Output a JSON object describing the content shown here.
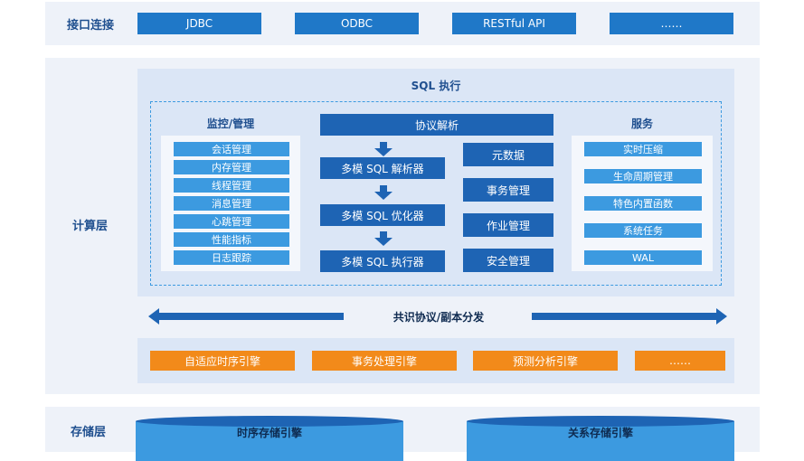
{
  "interface": {
    "label": "接口连接",
    "items": [
      "JDBC",
      "ODBC",
      "RESTful API",
      "……"
    ]
  },
  "compute": {
    "label": "计算层",
    "sql_title": "SQL 执行",
    "monitor": {
      "title": "监控/管理",
      "items": [
        "会话管理",
        "内存管理",
        "线程管理",
        "消息管理",
        "心跳管理",
        "性能指标",
        "日志跟踪"
      ]
    },
    "protocol": "协议解析",
    "pipeline": [
      "多模 SQL 解析器",
      "多模 SQL 优化器",
      "多模 SQL 执行器"
    ],
    "mid": [
      "元数据",
      "事务管理",
      "作业管理",
      "安全管理"
    ],
    "services": {
      "title": "服务",
      "items": [
        "实时压缩",
        "生命周期管理",
        "特色内置函数",
        "系统任务",
        "WAL"
      ]
    },
    "consensus": "共识协议/副本分发",
    "engines": [
      "自适应时序引擎",
      "事务处理引擎",
      "预测分析引擎",
      "……"
    ]
  },
  "storage": {
    "label": "存储层",
    "engines": [
      "时序存储引擎",
      "关系存储引擎"
    ]
  },
  "colors": {
    "panel": "#eef2f9",
    "blue": "#1f78c8",
    "dark_blue": "#1e64b4",
    "light_blue": "#3c9ae0",
    "orange": "#f28a1a"
  }
}
